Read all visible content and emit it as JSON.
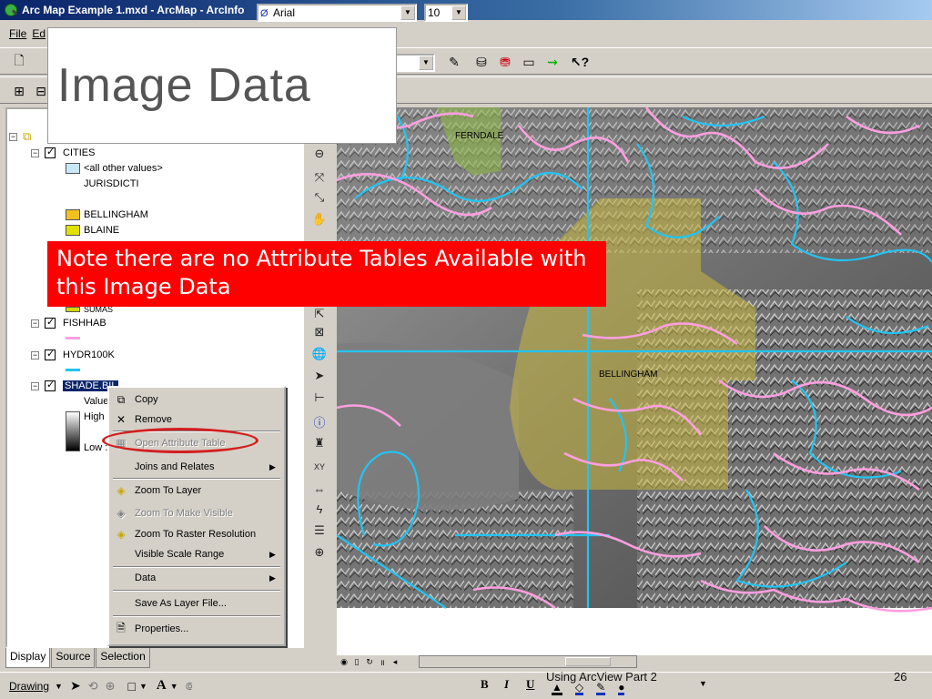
{
  "window": {
    "title": "Arc Map Example 1.mxd - ArcMap - ArcInfo"
  },
  "menubar": {
    "items": [
      "File",
      "Ed"
    ]
  },
  "slide": {
    "title": "Image Data",
    "note": "Note there are no Attribute Tables Available with this Image Data",
    "footer": "Using ArcView Part 2",
    "page_number": "26"
  },
  "toc": {
    "layers": [
      {
        "name": "CITIES"
      },
      {
        "name": "<all other values>"
      },
      {
        "name": "JURISDICTI"
      },
      {
        "name": "BELLINGHAM"
      },
      {
        "name": "BLAINE"
      },
      {
        "name": "SUMAS"
      },
      {
        "name": "FISHHAB"
      },
      {
        "name": "HYDR100K"
      },
      {
        "name": "SHADE.BIL"
      }
    ],
    "raster_legend": {
      "value_label": "Value",
      "high_label": "High :",
      "low_label": "Low :"
    },
    "tabs": [
      "Display",
      "Source",
      "Selection"
    ]
  },
  "context_menu": {
    "items": [
      {
        "label": "Copy",
        "icon": "copy-icon",
        "enabled": true
      },
      {
        "label": "Remove",
        "icon": "remove-icon",
        "enabled": true
      },
      {
        "label": "Open Attribute Table",
        "icon": "table-icon",
        "enabled": false
      },
      {
        "label": "Joins and Relates",
        "icon": "",
        "enabled": true,
        "submenu": true
      },
      {
        "label": "Zoom To Layer",
        "icon": "zoom-layer-icon",
        "enabled": true
      },
      {
        "label": "Zoom To Make Visible",
        "icon": "zoom-visible-icon",
        "enabled": false
      },
      {
        "label": "Zoom To Raster Resolution",
        "icon": "zoom-raster-icon",
        "enabled": true
      },
      {
        "label": "Visible Scale Range",
        "icon": "",
        "enabled": true,
        "submenu": true
      },
      {
        "label": "Data",
        "icon": "",
        "enabled": true,
        "submenu": true
      },
      {
        "label": "Save As Layer File...",
        "icon": "",
        "enabled": true
      },
      {
        "label": "Properties...",
        "icon": "properties-icon",
        "enabled": true
      }
    ]
  },
  "map": {
    "labels": [
      "FERNDALE",
      "BELLINGHAM"
    ]
  },
  "drawing_toolbar": {
    "drawing_label": "Drawing",
    "font_name": "Arial",
    "font_size": "10",
    "bold": "B",
    "italic": "I",
    "underline": "U",
    "text_tool": "A"
  },
  "colors": {
    "selection": "#0a246a",
    "note_bg": "#ff0000",
    "rivers": "#22c4f2",
    "streams": "#ff9fe0",
    "city_fill": "#c8b840"
  }
}
